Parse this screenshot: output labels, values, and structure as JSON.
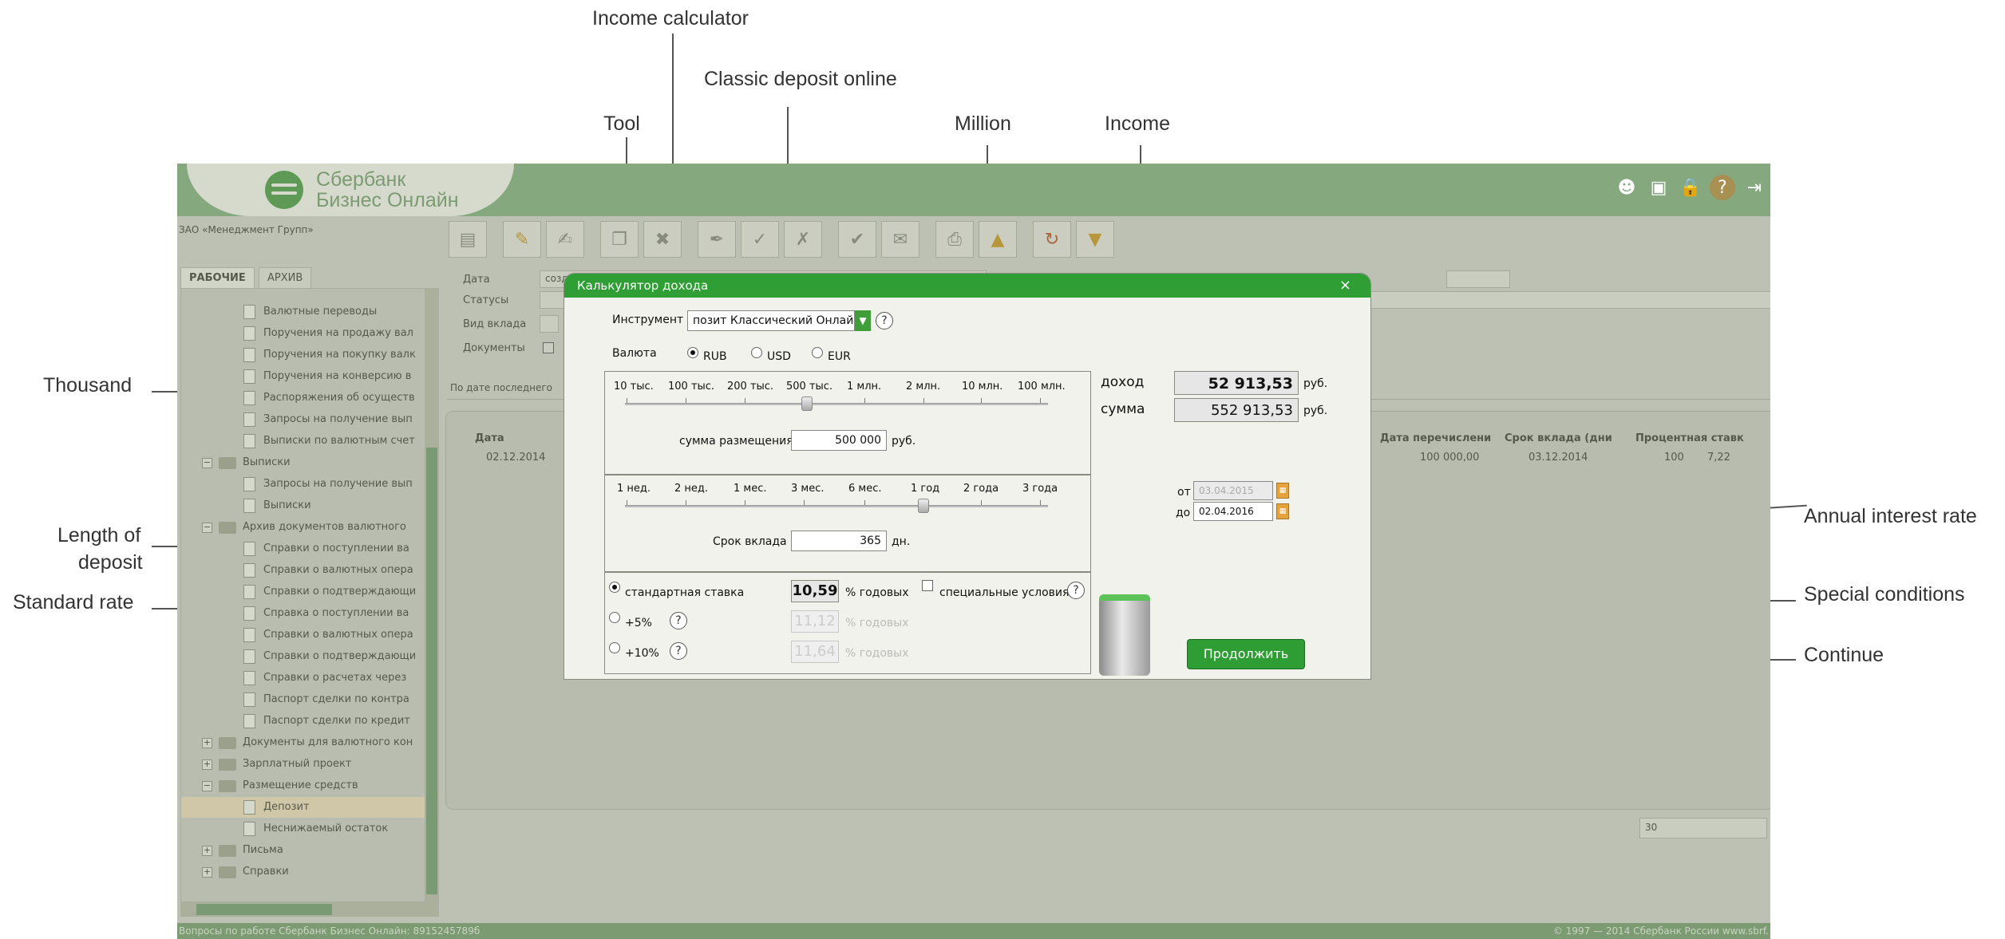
{
  "annotations": {
    "income_calculator": "Income calculator",
    "classic_deposit_online": "Classic deposit online",
    "tool": "Tool",
    "million": "Million",
    "income": "Income",
    "thousand": "Thousand",
    "length_of_deposit_1": "Length of",
    "length_of_deposit_2": "deposit",
    "standard_rate": "Standard rate",
    "annual_interest_rate": "Annual interest rate",
    "special_conditions": "Special conditions",
    "continue": "Continue"
  },
  "app": {
    "logo": {
      "line1": "Сбербанк",
      "line2": "Бизнес Онлайн"
    },
    "org_name": "ЗАО «Менеджмент Групп»",
    "footer_left": "Вопросы по работе Сбербанк Бизнес Онлайн: 8915245789б",
    "footer_right": "© 1997 — 2014 Сбербанк России  www.sbrf."
  },
  "sidebar": {
    "tab_work": "РАБОЧИЕ",
    "tab_archive": "АРХИВ",
    "items": [
      {
        "label": "Валютные переводы"
      },
      {
        "label": "Поручения на продажу вал"
      },
      {
        "label": "Поручения на покупку валк"
      },
      {
        "label": "Поручения на конверсию в"
      },
      {
        "label": "Распоряжения об осуществ"
      },
      {
        "label": "Запросы на получение вып"
      },
      {
        "label": "Выписки по валютным счет"
      },
      {
        "label": "Выписки"
      },
      {
        "label": "Запросы на получение вып"
      },
      {
        "label": "Выписки"
      },
      {
        "label": "Архив документов валютного"
      },
      {
        "label": "Справки о поступлении ва"
      },
      {
        "label": "Справки о валютных опера"
      },
      {
        "label": "Справки о подтверждающи"
      },
      {
        "label": "Справка о поступлении ва"
      },
      {
        "label": "Справки о валютных опера"
      },
      {
        "label": "Справки о подтверждающи"
      },
      {
        "label": "Справки о расчетах через"
      },
      {
        "label": "Паспорт сделки по контра"
      },
      {
        "label": "Паспорт сделки по кредит"
      },
      {
        "label": "Документы для валютного кон"
      },
      {
        "label": "Зарплатный проект"
      },
      {
        "label": "Размещение средств"
      },
      {
        "label": "Депозит"
      },
      {
        "label": "Неснижаемый остаток"
      },
      {
        "label": "Письма"
      },
      {
        "label": "Справки"
      }
    ]
  },
  "filters": {
    "date_label": "Дата",
    "date_mode": "созд",
    "statuses_label": "Статусы",
    "deposit_type_label": "Вид вклада",
    "documents_label": "Документы",
    "by_date_label": "По дате последнего"
  },
  "list": {
    "headers": {
      "date": "Дата",
      "transfer_date": "Дата перечислени",
      "term": "Срок вклада (дни",
      "rate": "Процентная ставк"
    },
    "rows": [
      {
        "date": "02.12.2014",
        "amount": "100 000,00",
        "term_date": "03.12.2014",
        "days": "100",
        "rate": "7,22"
      }
    ],
    "page_size": "30"
  },
  "dialog": {
    "title": "Калькулятор дохода",
    "instrument_label": "Инструмент",
    "instrument_value": "позит Классический Онлайн",
    "currency_label": "Валюта",
    "currencies": [
      {
        "label": "RUB",
        "checked": true
      },
      {
        "label": "USD",
        "checked": false
      },
      {
        "label": "EUR",
        "checked": false
      }
    ],
    "amount_ticks": [
      "10 тыс.",
      "100 тыс.",
      "200 тыс.",
      "500 тыс.",
      "1 млн.",
      "2 млн.",
      "10 млн.",
      "100 млн."
    ],
    "amount_label": "сумма размещения",
    "amount_value": "500 000",
    "amount_unit": "руб.",
    "term_ticks": [
      "1 нед.",
      "2 нед.",
      "1 мес.",
      "3 мес.",
      "6 мес.",
      "1 год",
      "2 года",
      "3 года"
    ],
    "term_label": "Срок вклада",
    "term_value": "365",
    "term_unit": "дн.",
    "rates": [
      {
        "label": "стандартная ставка",
        "value": "10,59",
        "unit": "% годовых",
        "checked": true
      },
      {
        "label": "+5%",
        "value": "11,12",
        "unit": "% годовых",
        "checked": false
      },
      {
        "label": "+10%",
        "value": "11,64",
        "unit": "% годовых",
        "checked": false
      }
    ],
    "special_conditions_label": "специальные условия",
    "income_label": "доход",
    "income_value": "52 913,53",
    "sum_label": "сумма",
    "sum_value": "552 913,53",
    "currency_unit": "руб.",
    "from_label": "от",
    "from_date": "03.04.2015",
    "to_label": "до",
    "to_date": "02.04.2016",
    "continue_label": "Продолжить"
  }
}
